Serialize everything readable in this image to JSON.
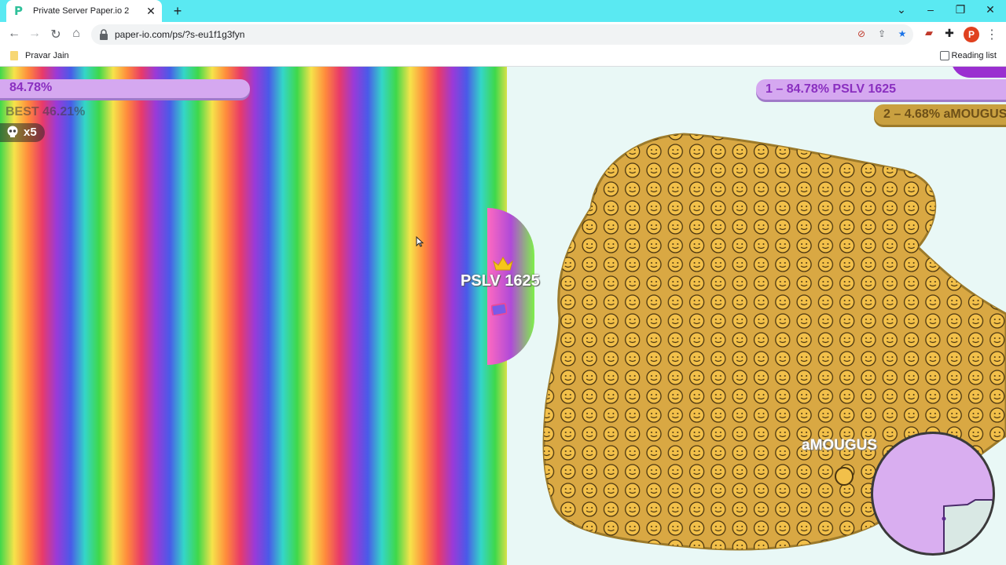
{
  "browser": {
    "tab_title": "Private Server Paper.io 2",
    "tab_close": "✕",
    "new_tab": "+",
    "url": "paper-io.com/ps/?s-eu1f1g3fyn",
    "profile_initial": "P",
    "bookmark_label": "Pravar Jain",
    "reading_list": "Reading list"
  },
  "hud": {
    "percent": "84.78%",
    "best": "BEST 46.21%",
    "kills": "x5"
  },
  "leaderboard": {
    "first": "1 – 84.78% PSLV 1625",
    "second": "2 – 4.68% aMOUGUS"
  },
  "players": {
    "me": "PSLV 1625",
    "enemy": "aMOUGUS"
  },
  "colors": {
    "player_territory": "#d5a8f0",
    "enemy_territory": "#d9a843",
    "background": "#e9f8f6",
    "chrome_tabbar": "#5ae9f2"
  },
  "icons": [
    "back-icon",
    "forward-icon",
    "reload-icon",
    "home-icon",
    "lock-icon",
    "share-icon",
    "star-icon",
    "extensions-icon",
    "menu-icon",
    "skull-icon",
    "crown-icon",
    "cursor-icon"
  ]
}
